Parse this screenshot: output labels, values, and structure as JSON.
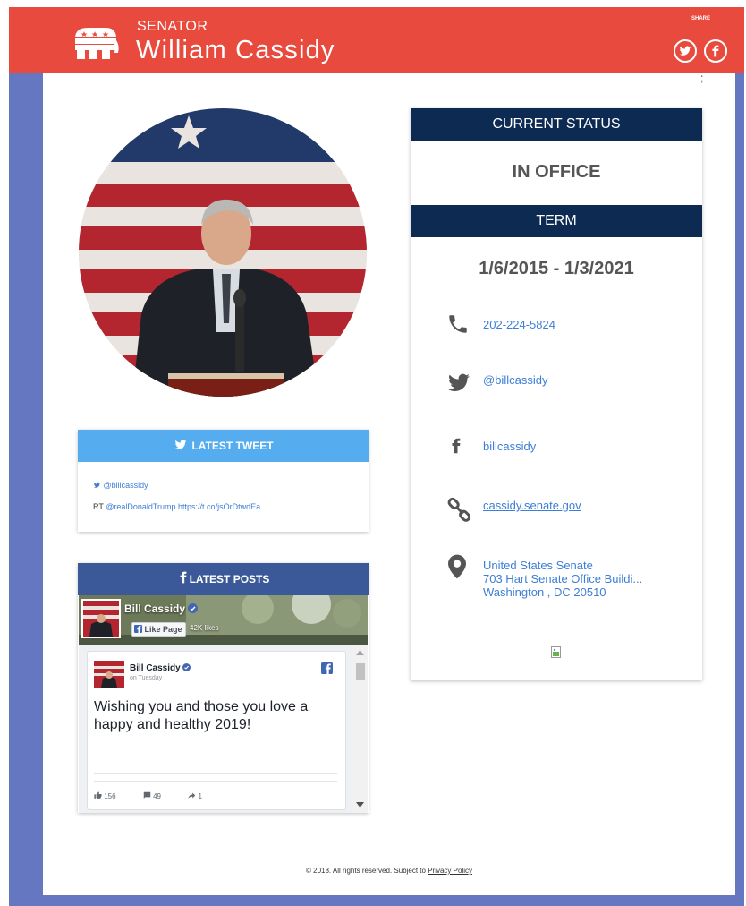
{
  "header": {
    "title_label": "SENATOR",
    "name": "William Cassidy",
    "share_label": "SHARE"
  },
  "status": {
    "heading": "CURRENT STATUS",
    "value": "IN OFFICE"
  },
  "term": {
    "heading": "TERM",
    "value": "1/6/2015 - 1/3/2021"
  },
  "contact": {
    "phone": "202-224-5824",
    "twitter": "@billcassidy",
    "facebook": "billcassidy",
    "website": "cassidy.senate.gov",
    "address_line1": "United States Senate",
    "address_line2": "703 Hart Senate Office Buildi...",
    "address_line3": "Washington , DC 20510"
  },
  "tweet": {
    "heading": "LATEST TWEET",
    "handle": "@billcassidy",
    "prefix": "RT",
    "mention": "@realDonaldTrump",
    "link": "https://t.co/jsOrDtwdEa"
  },
  "posts": {
    "heading": "LATEST POSTS",
    "page_name": "Bill Cassidy",
    "like_button": "Like Page",
    "likes": "42K likes",
    "author": "Bill Cassidy",
    "time": "on Tuesday",
    "text": "Wishing you and those you love a happy and healthy 2019!",
    "reactions": "156",
    "comments": "49",
    "shares": "1"
  },
  "footer": {
    "text": "© 2018. All rights reserved. Subject to",
    "link": "Privacy Policy"
  },
  "colors": {
    "header_red": "#e84b3e",
    "side_blue": "#6477c0",
    "navy": "#0d2a52",
    "twitter_blue": "#55acee",
    "facebook_blue": "#3b5998",
    "link_blue": "#3d7ed6"
  },
  "icons": {
    "logo": "republican-elephant-icon",
    "share_twitter": "twitter-icon",
    "share_facebook": "facebook-icon",
    "phone": "phone-icon",
    "twitter": "twitter-icon",
    "facebook": "facebook-icon",
    "website": "link-icon",
    "address": "map-pin-icon"
  }
}
